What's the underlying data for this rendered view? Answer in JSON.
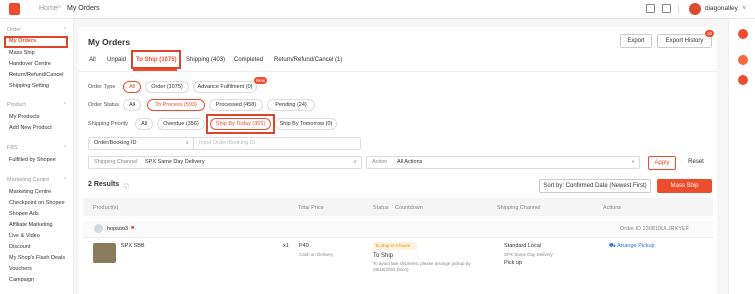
{
  "topbar": {
    "home": "Home",
    "separator": ">",
    "current": "My Orders",
    "username": "diagonalley",
    "caret": "∨"
  },
  "sidebar": {
    "sections": [
      {
        "title": "Order",
        "items": [
          "My Orders",
          "Mass Ship",
          "Handover Centre",
          "Return/Refund/Cancel",
          "Shipping Setting"
        ]
      },
      {
        "title": "Product",
        "items": [
          "My Products",
          "Add New Product"
        ]
      },
      {
        "title": "FBS",
        "items": [
          "Fulfilled by Shopee"
        ]
      },
      {
        "title": "Marketing Centre",
        "items": [
          "Marketing Centre",
          "Checkpoint on Shopee",
          "Shopee Ads",
          "Affiliate Marketing",
          "Live & Video",
          "Discount",
          "My Shop's Flash Deals",
          "Vouchers",
          "Campaign"
        ]
      }
    ],
    "caret": "^"
  },
  "main": {
    "title": "My Orders",
    "export_label": "Export",
    "export_history_label": "Export History",
    "export_history_badge": "10",
    "tabs": [
      "All",
      "Unpaid",
      "To Ship (1075)",
      "Shipping (403)",
      "Completed",
      "Return/Refund/Cancel (1)"
    ],
    "order_type_label": "Order Type",
    "order_type_pills": [
      "All",
      "Order (1075)",
      "Advance Fulfilment (0)"
    ],
    "new_badge": "New",
    "order_status_label": "Order Status",
    "order_status_pills": [
      "All",
      "To Process (593)",
      "Processed (458)",
      "Pending (24)"
    ],
    "shipping_priority_label": "Shipping Priority",
    "shipping_priority_pills": [
      "All",
      "Overdue (356)",
      "Ship By Today (355)",
      "Ship By Tomorrow (0)"
    ],
    "search_field_select": "Order/Booking ID",
    "search_placeholder": "Input Order/Booking ID",
    "shipping_channel_label": "Shipping Channel",
    "shipping_channel_value": "SPX Same Day Delivery",
    "action_label": "Action",
    "action_value": "All Actions",
    "apply_label": "Apply",
    "reset_label": "Reset",
    "results": "2 Results",
    "sort_label": "Sort by: Confirmed Date (Newest First)",
    "mass_ship_label": "Mass Ship",
    "table_headers": [
      "Product(s)",
      "Total Price",
      "Status",
      "Countdown",
      "Shipping Channel",
      "Actions"
    ],
    "order": {
      "buyer": "hopsoo3",
      "order_id": "Order ID 230810ULJRKYEF",
      "product_name": "SPX SBB",
      "quantity": "x1",
      "price": "P40",
      "payment": "Cash on Delivery",
      "tag": "To ship in 3 hours",
      "status": "To Ship",
      "status_note_1": "To avoid late shipment, please arrange pickup by",
      "status_note_2": "08/10/2023 (Mon)",
      "channel": "Standard Local",
      "channel_sub": "SPX Same Day Delivery",
      "channel_method": "Pick up",
      "action": "Arrange Pickup"
    }
  },
  "colors": {
    "accent": "#ee4d2d",
    "highlight": "#e0452b"
  }
}
